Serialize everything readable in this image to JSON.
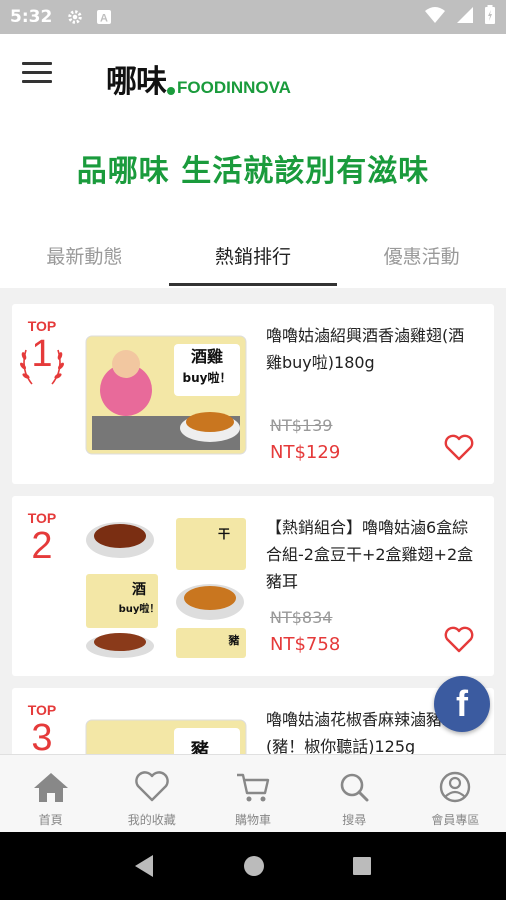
{
  "status_bar": {
    "time": "5:32"
  },
  "header": {
    "brand_cn": "哪味",
    "brand_en": "FOODINNOVA"
  },
  "slogan": "品哪味  生活就該別有滋味",
  "tabs": [
    {
      "label": "最新動態",
      "active": false
    },
    {
      "label": "熱銷排行",
      "active": true
    },
    {
      "label": "優惠活動",
      "active": false
    }
  ],
  "products": [
    {
      "top": "TOP",
      "rank": "1",
      "name": "嚕嚕姑滷紹興酒香滷雞翅(酒雞buy啦)180g",
      "old_price": "NT$139",
      "price": "NT$129",
      "image_label": "酒雞buy啦！"
    },
    {
      "top": "TOP",
      "rank": "2",
      "name": "【熱銷組合】嚕嚕姑滷6盒綜合組-2盒豆干+2盒雞翅+2盒豬耳",
      "old_price": "NT$834",
      "price": "NT$758",
      "image_label": "酒 buy啦！"
    },
    {
      "top": "TOP",
      "rank": "3",
      "name": "嚕嚕姑滷花椒香麻辣滷豬耳(豬！椒你聽話)125g",
      "old_price": "",
      "price": "",
      "image_label": "豬"
    }
  ],
  "facebook": {
    "label": "f"
  },
  "bottom_nav": [
    {
      "label": "首頁",
      "icon": "home-icon"
    },
    {
      "label": "我的收藏",
      "icon": "heart-icon"
    },
    {
      "label": "購物車",
      "icon": "cart-icon"
    },
    {
      "label": "搜尋",
      "icon": "search-icon"
    },
    {
      "label": "會員專區",
      "icon": "user-icon"
    }
  ],
  "colors": {
    "brand_green": "#1a9b3c",
    "price_red": "#e53a3a",
    "facebook_blue": "#3b5ba0"
  }
}
